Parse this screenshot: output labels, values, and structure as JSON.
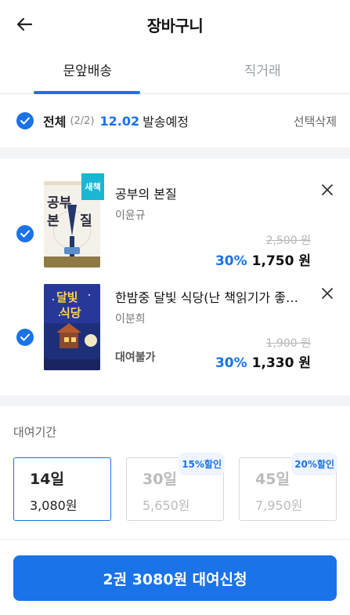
{
  "header": {
    "title": "장바구니"
  },
  "tabs": [
    {
      "label": "문앞배송",
      "active": true
    },
    {
      "label": "직거래",
      "active": false
    }
  ],
  "selection": {
    "all_label": "전체",
    "count": "(2/2)",
    "ship_date": "12.02",
    "ship_label": "발송예정",
    "delete_label": "선택삭제"
  },
  "items": [
    {
      "title": "공부의 본질",
      "author": "이윤규",
      "badge": "새책",
      "cover_text": "공부의 본질",
      "original_price": "2,500 원",
      "discount": "30%",
      "price": "1,750 원",
      "rental_note": ""
    },
    {
      "title": "한밤중 달빛 식당(난 책읽기가 좋…",
      "author": "이분희",
      "badge": "",
      "cover_text": "한밤중 달빛 식당",
      "original_price": "1,900 원",
      "discount": "30%",
      "price": "1,330 원",
      "rental_note": "대여불가"
    }
  ],
  "rental": {
    "label": "대여기간",
    "periods": [
      {
        "days": "14일",
        "price": "3,080원",
        "discount": "",
        "selected": true
      },
      {
        "days": "30일",
        "price": "5,650원",
        "discount": "15%할인",
        "selected": false
      },
      {
        "days": "45일",
        "price": "7,950원",
        "discount": "20%할인",
        "selected": false
      }
    ]
  },
  "cta": {
    "label": "2권 3080원 대여신청"
  },
  "colors": {
    "accent": "#1a73e8",
    "badge": "#1ab6d4"
  }
}
